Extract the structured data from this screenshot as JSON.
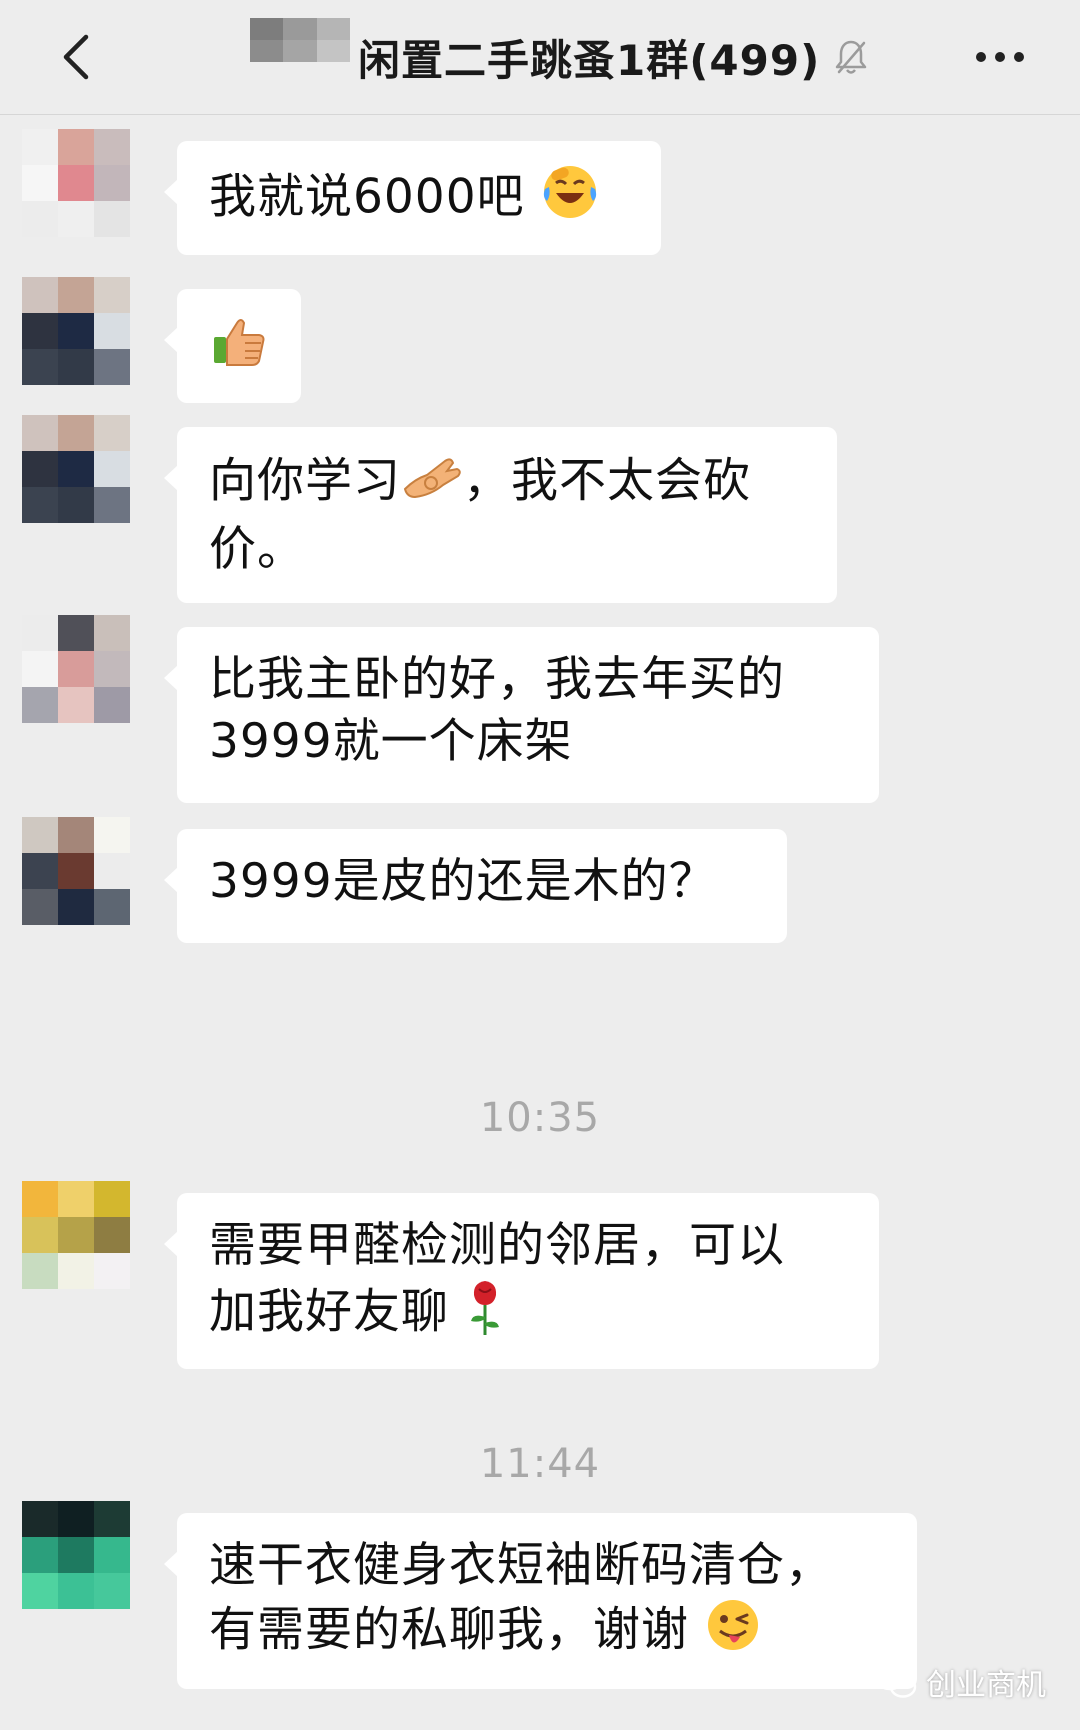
{
  "header": {
    "title": "闲置二手跳蚤1群(499)",
    "back_icon": "chevron-left-icon",
    "mute_icon": "bell-off-icon",
    "more_icon": "more-dots-icon"
  },
  "messages": [
    {
      "text": "我就说6000吧",
      "emoji": "laugh-cry-emoji"
    },
    {
      "text": "",
      "emoji": "thumbs-up-emoji"
    },
    {
      "line1_before": "向你学习",
      "line1_emoji": "ok-hand-emoji",
      "line1_after": "，我不太会砍",
      "line2": "价。"
    },
    {
      "line1": "比我主卧的好，我去年买的",
      "line2": "3999就一个床架"
    },
    {
      "text": "3999是皮的还是木的？"
    },
    {
      "line1": "需要甲醛检测的邻居，可以",
      "line2": "加我好友聊",
      "emoji": "rose-emoji"
    },
    {
      "line1": "速干衣健身衣短袖断码清仓，",
      "line2": "有需要的私聊我，谢谢",
      "emoji": "wink-tongue-emoji"
    }
  ],
  "timestamps": [
    "10:35",
    "11:44"
  ],
  "watermark": {
    "text": "创业商机",
    "icon": "wechat-logo-icon"
  },
  "colors": {
    "background": "#ededed",
    "bubble": "#ffffff",
    "timestamp": "#a8a8a8"
  }
}
